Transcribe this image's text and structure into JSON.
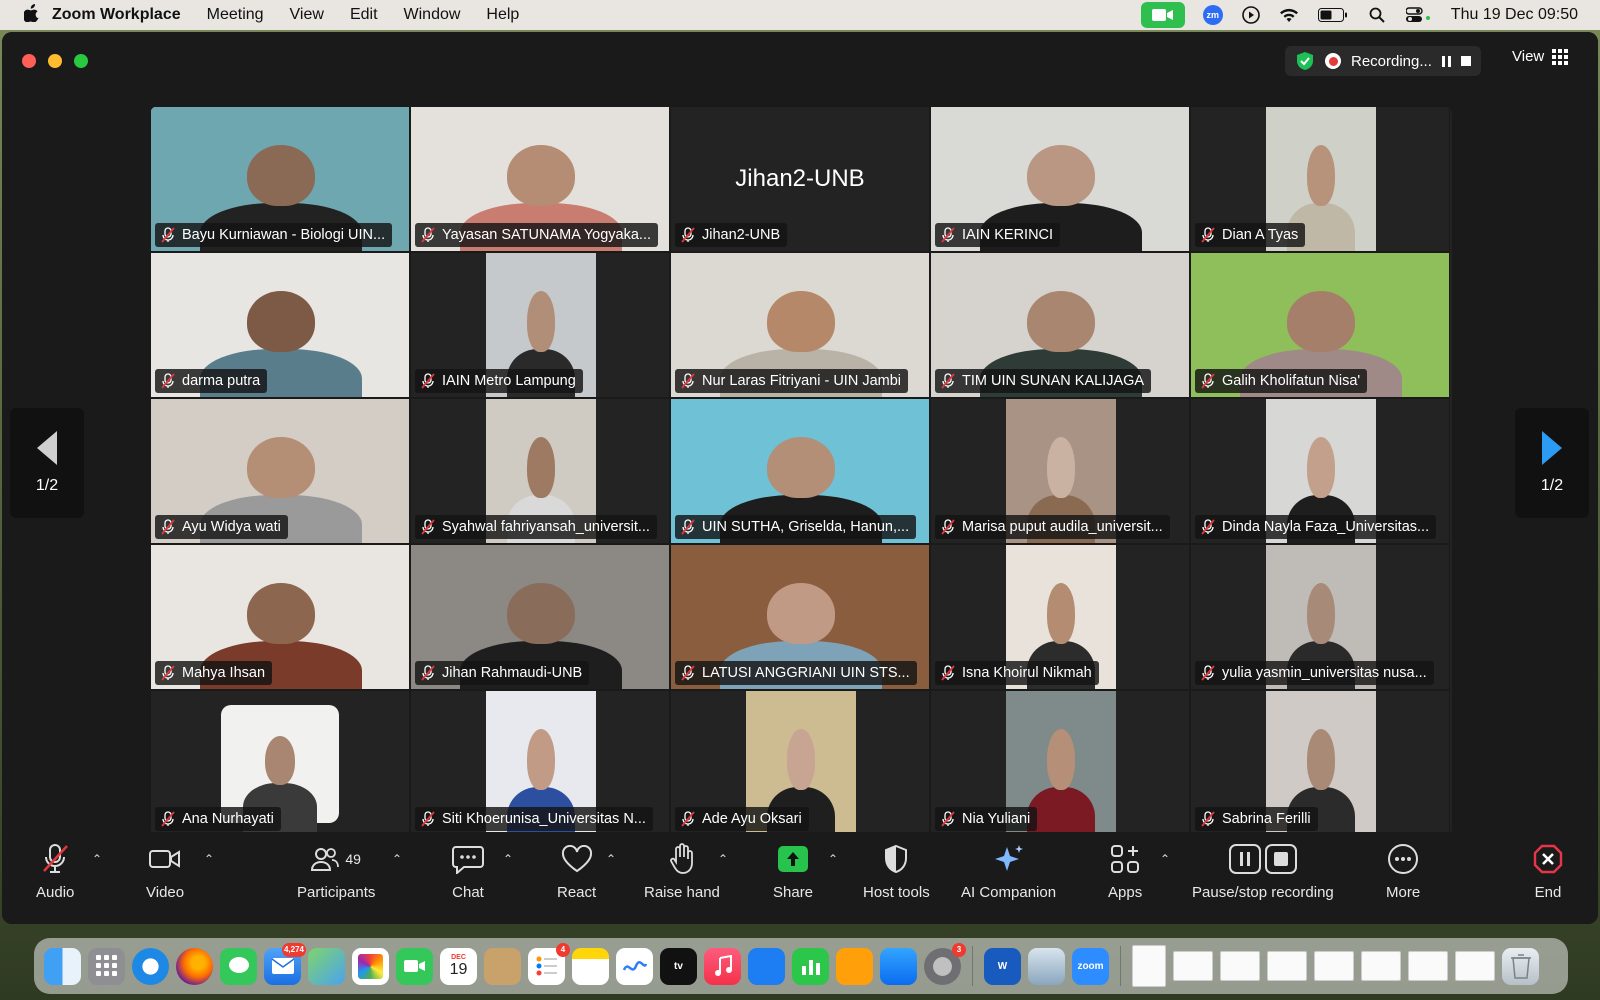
{
  "menubar": {
    "app_name": "Zoom Workplace",
    "items": [
      "Meeting",
      "View",
      "Edit",
      "Window",
      "Help"
    ],
    "clock": "Thu 19 Dec  09:50",
    "zoom_badge": "zm"
  },
  "titlebar": {
    "recording_label": "Recording...",
    "view_label": "View"
  },
  "pager": {
    "left_label": "1/2",
    "right_label": "1/2"
  },
  "tiles": [
    {
      "name": "Bayu Kurniawan - Biologi UIN...",
      "bg": "#6fa7b0",
      "photo": "full",
      "skin": "#8a6a55",
      "cloth": "#222"
    },
    {
      "name": "Yayasan SATUNAMA Yogyaka...",
      "bg": "#e4e1dc",
      "photo": "full",
      "skin": "#b58c74",
      "cloth": "#c97d70"
    },
    {
      "name": "Jihan2-UNB",
      "big": "Jihan2-UNB",
      "bg": "#232323",
      "photo": "none"
    },
    {
      "name": "IAIN KERINCI",
      "bg": "#d9d9d6",
      "photo": "full",
      "skin": "#b99782",
      "cloth": "#1d1d1d"
    },
    {
      "name": "Dian A Tyas",
      "bg": "#cfd0c8",
      "photo": "center",
      "skin": "#b8937b",
      "cloth": "#c0b8a6"
    },
    {
      "name": "darma putra",
      "bg": "#e7e6e2",
      "photo": "full",
      "skin": "#7c5a45",
      "cloth": "#5a7d8c"
    },
    {
      "name": "IAIN Metro Lampung",
      "bg": "#c5c9cc",
      "photo": "center",
      "skin": "#b08e78",
      "cloth": "#2a2a2a"
    },
    {
      "name": "Nur Laras Fitriyani - UIN Jambi",
      "bg": "#dcd8d2",
      "photo": "full",
      "skin": "#b48869",
      "cloth": "#b9b2a6"
    },
    {
      "name": "TIM UIN SUNAN KALIJAGA",
      "bg": "#d6d3cf",
      "photo": "full",
      "skin": "#a98670",
      "cloth": "#2f3b36"
    },
    {
      "name": "Galih Kholifatun Nisa'",
      "bg": "#8fbf5a",
      "photo": "full",
      "skin": "#a67f6a",
      "cloth": "#a08a88"
    },
    {
      "name": "Ayu Widya wati",
      "bg": "#d3cdc6",
      "photo": "full",
      "skin": "#b48e75",
      "cloth": "#9a9a9a"
    },
    {
      "name": "Syahwal fahriyansah_universit...",
      "bg": "#cfcac2",
      "photo": "center",
      "skin": "#9e7a63",
      "cloth": "#d9d9d9"
    },
    {
      "name": "UIN SUTHA, Griselda, Hanun,...",
      "bg": "#6fc1d6",
      "photo": "full",
      "skin": "#b38f78",
      "cloth": "#1d1d1d"
    },
    {
      "name": "Marisa puput audila_universit...",
      "bg": "#a89384",
      "photo": "center",
      "skin": "#c9b2a2",
      "cloth": "#8b6a52"
    },
    {
      "name": "Dinda Nayla Faza_Universitas...",
      "bg": "#d7d7d5",
      "photo": "center",
      "skin": "#c2a08c",
      "cloth": "#1e1e1e"
    },
    {
      "name": "Mahya Ihsan",
      "bg": "#e9e6e1",
      "photo": "full",
      "skin": "#8d6650",
      "cloth": "#7a3b2a"
    },
    {
      "name": "Jihan Rahmaudi-UNB",
      "bg": "#8c8985",
      "photo": "full",
      "skin": "#8a6c5a",
      "cloth": "#1e1e1e"
    },
    {
      "name": "LATUSI ANGGRIANI UIN STS...",
      "bg": "#8a5d3f",
      "photo": "full",
      "skin": "#c09a84",
      "cloth": "#7ea3b8"
    },
    {
      "name": "Isna Khoirul Nikmah",
      "bg": "#e8e2da",
      "photo": "center",
      "skin": "#b48c72",
      "cloth": "#2c2c2c"
    },
    {
      "name": "yulia yasmin_universitas nusa...",
      "bg": "#bfbcb7",
      "photo": "center",
      "skin": "#a88a78",
      "cloth": "#2a2a2a"
    },
    {
      "name": "Ana Nurhayati",
      "bg": "#f1f1f0",
      "photo": "small",
      "skin": "#a98672",
      "cloth": "#3a3a3a"
    },
    {
      "name": "Siti Khoerunisa_Universitas N...",
      "bg": "#e7e9ee",
      "photo": "center",
      "skin": "#c29b86",
      "cloth": "#2d4fa0"
    },
    {
      "name": "Ade Ayu Oksari",
      "bg": "#cdbb92",
      "photo": "center",
      "skin": "#c7a592",
      "cloth": "#1f1f1f"
    },
    {
      "name": "Nia Yuliani",
      "bg": "#7f8a8a",
      "photo": "center",
      "skin": "#b58f77",
      "cloth": "#7b1a22"
    },
    {
      "name": "Sabrina Ferilli",
      "bg": "#cfcac5",
      "photo": "center",
      "skin": "#a98a77",
      "cloth": "#2b2b2b"
    }
  ],
  "toolbar": {
    "audio": "Audio",
    "video": "Video",
    "participants": "Participants",
    "participants_count": "49",
    "chat": "Chat",
    "react": "React",
    "raise_hand": "Raise hand",
    "share": "Share",
    "host_tools": "Host tools",
    "ai_companion": "AI Companion",
    "apps": "Apps",
    "pause_stop_recording": "Pause/stop recording",
    "more": "More",
    "end": "End"
  },
  "dock": {
    "mail_badge": "4,274",
    "reminders_badge": "4",
    "settings_badge": "3",
    "calendar_month": "DEC",
    "calendar_day": "19",
    "zoom_label": "zoom",
    "tv_label": "tv"
  },
  "colors": {
    "window_bg": "#1a1a1a",
    "share_green": "#27c34d",
    "end_red": "#e8354a",
    "pager_arrow_blue": "#2b9bf4",
    "mute_red": "#e0383e"
  }
}
